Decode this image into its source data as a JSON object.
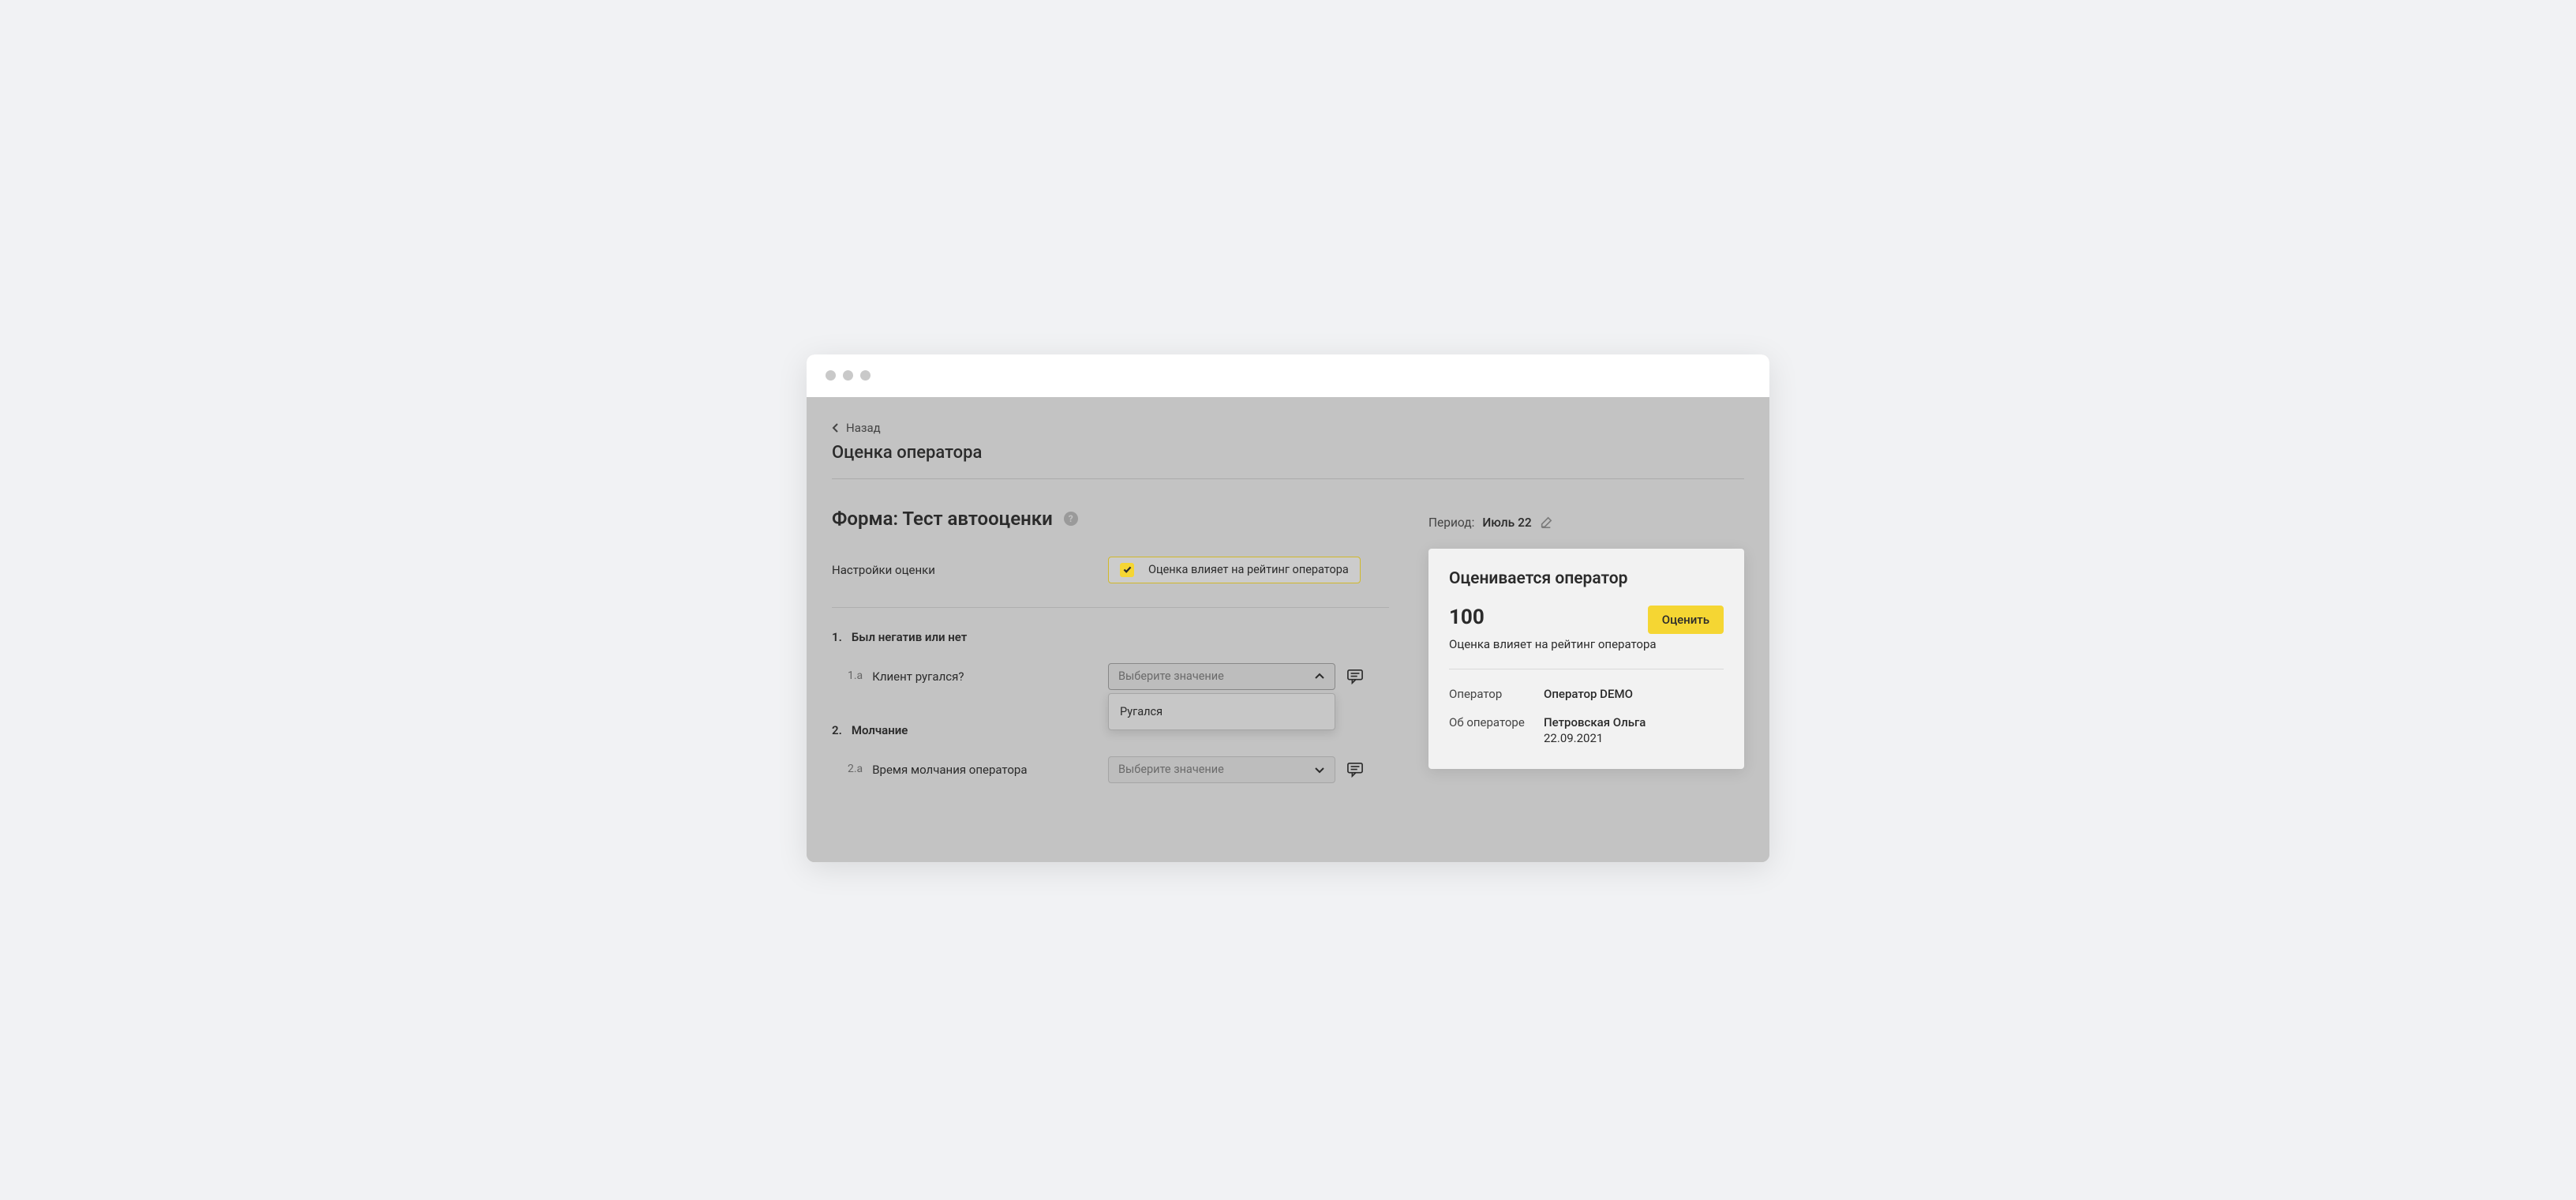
{
  "back_label": "Назад",
  "page_title": "Оценка оператора",
  "form_title": "Форма: Тест автооценки",
  "settings_label": "Настройки оценки",
  "settings_checkbox_label": "Оценка влияет на рейтинг оператора",
  "sections": [
    {
      "num": "1.",
      "title": "Был негатив или нет",
      "q_num": "1.a",
      "q_label": "Клиент ругался?",
      "placeholder": "Выберите значение",
      "option": "Ругался",
      "open": true
    },
    {
      "num": "2.",
      "title": "Молчание",
      "q_num": "2.a",
      "q_label": "Время молчания оператора",
      "placeholder": "Выберите значение",
      "option": "",
      "open": false
    }
  ],
  "period_label": "Период:",
  "period_value": "Июль 22",
  "card": {
    "title": "Оценивается оператор",
    "score": "100",
    "rate_button": "Оценить",
    "subtitle": "Оценка влияет на рейтинг оператора",
    "operator_label": "Оператор",
    "operator_value": "Оператор DEMO",
    "about_label": "Об операторе",
    "about_name": "Петровская Ольга",
    "about_date": "22.09.2021"
  }
}
